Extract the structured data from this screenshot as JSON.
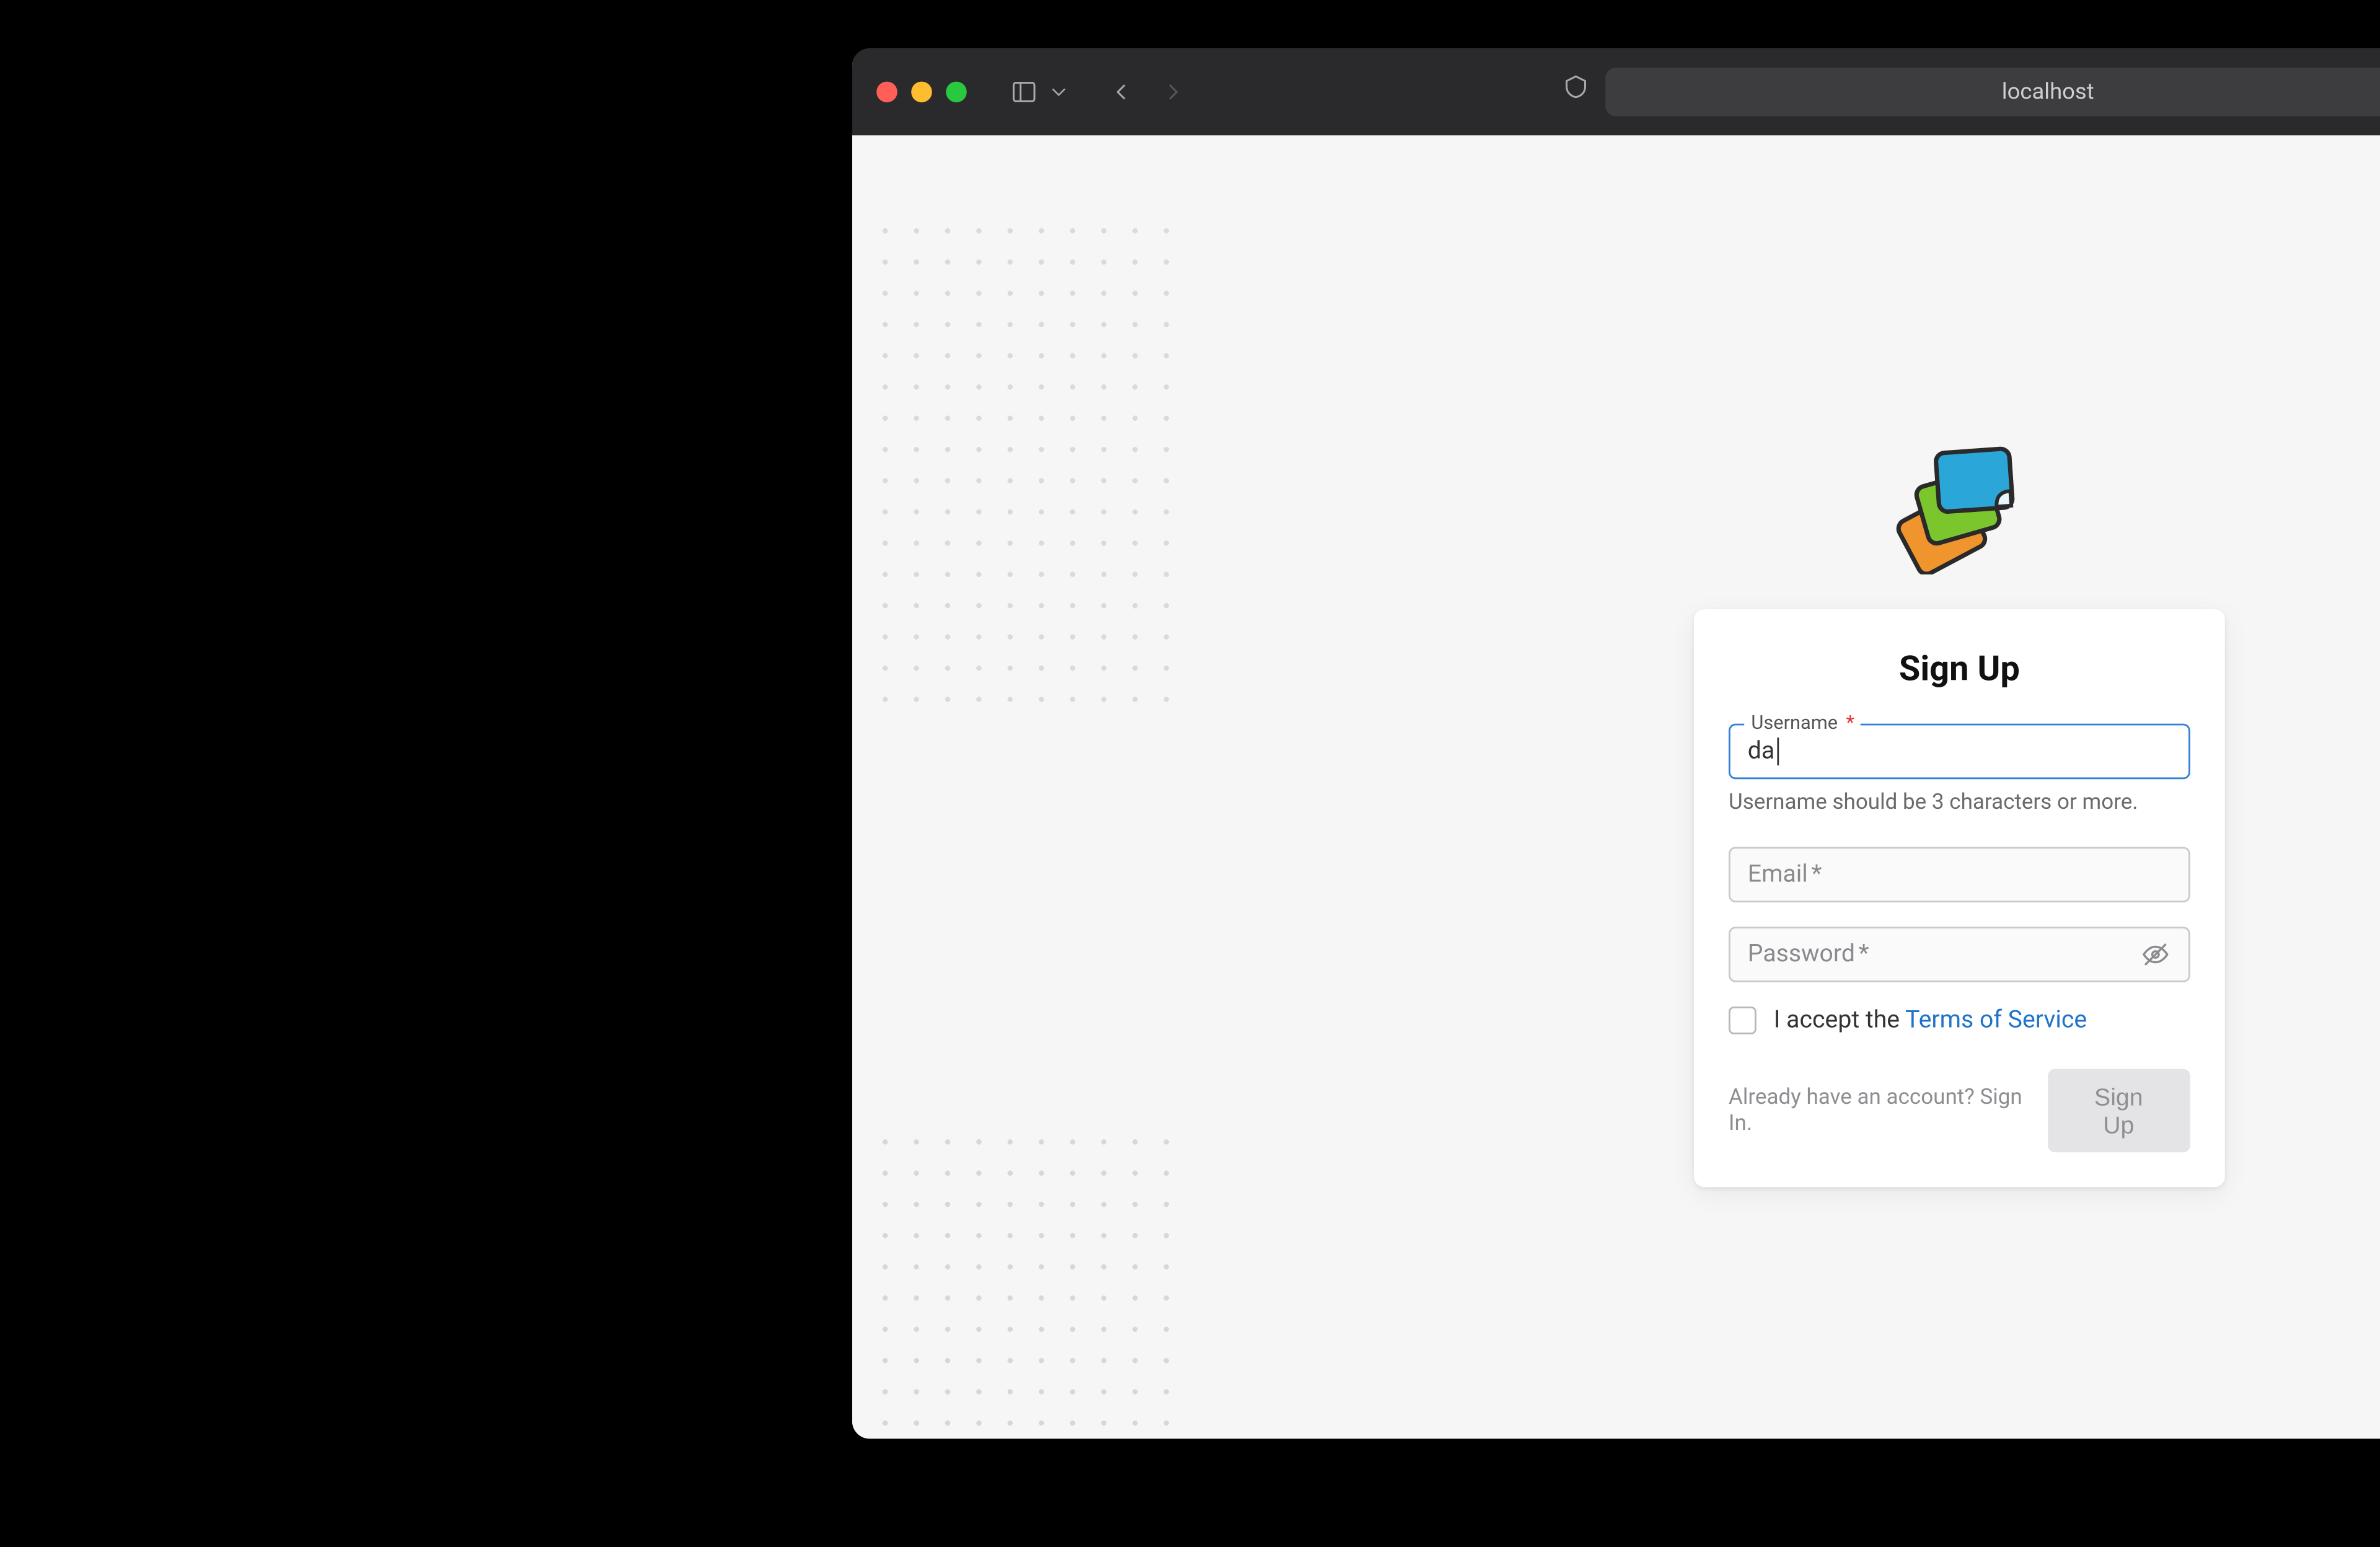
{
  "browser": {
    "address": "localhost"
  },
  "signup": {
    "title": "Sign Up",
    "username": {
      "label": "Username",
      "required_mark": "*",
      "value": "da",
      "helper": "Username should be 3 characters or more."
    },
    "email": {
      "placeholder": "Email",
      "required_mark": "*",
      "value": ""
    },
    "password": {
      "placeholder": "Password",
      "required_mark": "*",
      "value": ""
    },
    "terms": {
      "prefix": "I accept the ",
      "link": "Terms of Service",
      "checked": false
    },
    "signin": {
      "prefix": "Already have an account? ",
      "link": "Sign In."
    },
    "submit_label": "Sign Up"
  }
}
